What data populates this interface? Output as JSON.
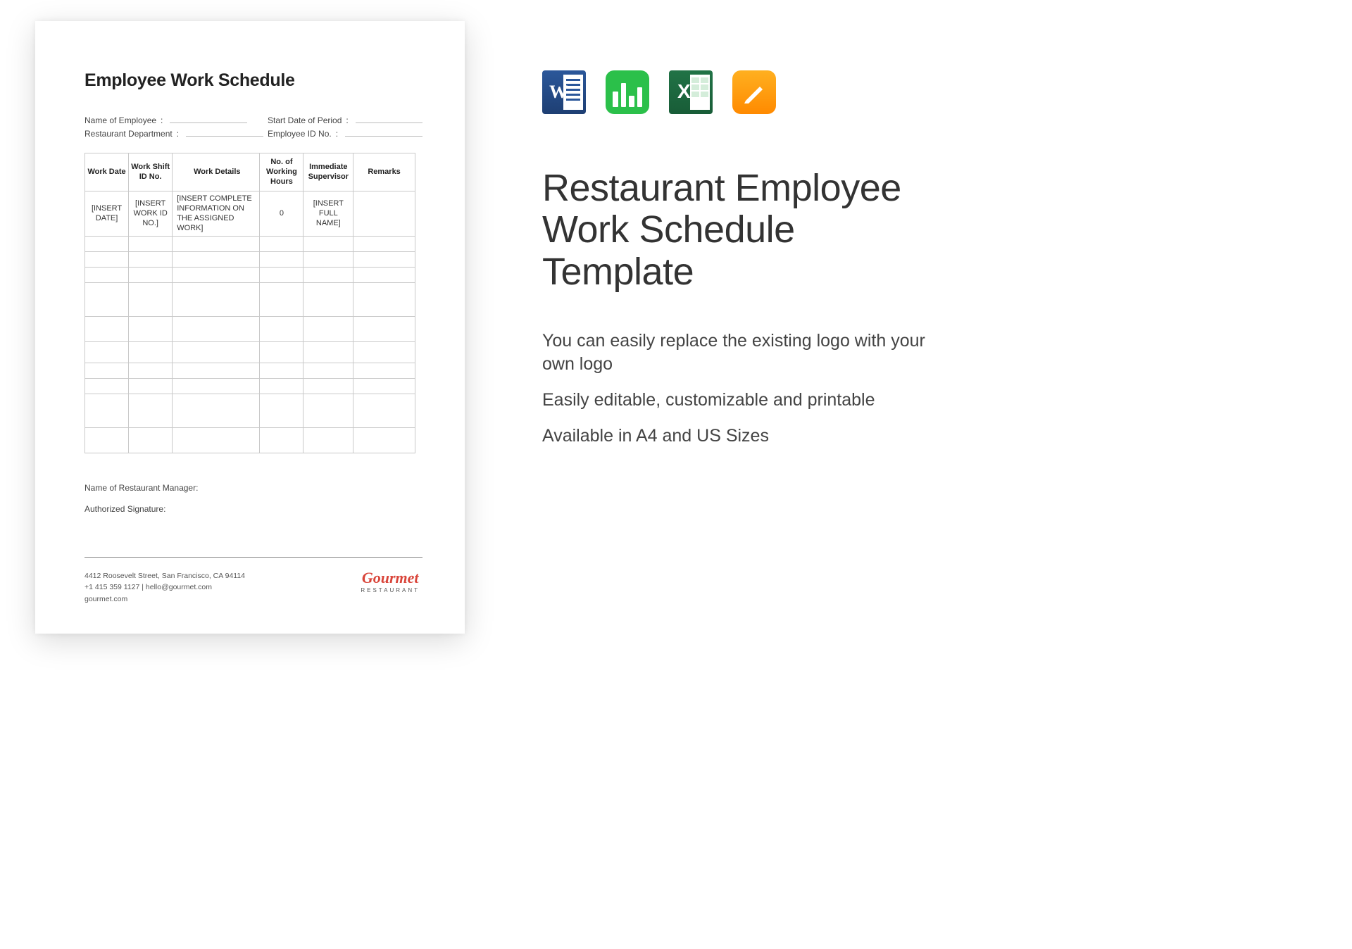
{
  "document": {
    "title": "Employee Work Schedule",
    "meta": {
      "left": [
        {
          "label": "Name of Employee"
        },
        {
          "label": "Restaurant Department"
        }
      ],
      "right": [
        {
          "label": "Start Date of Period"
        },
        {
          "label": "Employee ID No."
        }
      ]
    },
    "table": {
      "headers": [
        "Work Date",
        "Work Shift ID No.",
        "Work Details",
        "No. of Working Hours",
        "Immediate Supervisor",
        "Remarks"
      ],
      "rows": [
        {
          "date": "[INSERT DATE]",
          "shift": "[INSERT WORK ID NO.]",
          "details": "[INSERT COMPLETE INFORMATION ON THE ASSIGNED WORK]",
          "hours": "0",
          "supervisor": "[INSERT FULL NAME]",
          "remarks": ""
        }
      ],
      "blank_rows": 10
    },
    "signature": {
      "manager_label": "Name of Restaurant Manager:",
      "auth_label": "Authorized Signature:"
    },
    "footer": {
      "address": "4412 Roosevelt Street, San Francisco, CA 94114",
      "contact": "+1 415 359 1127 | hello@gourmet.com",
      "website": "gourmet.com",
      "logo_main": "Gourmet",
      "logo_sub": "RESTAURANT"
    }
  },
  "sidebar": {
    "icons": [
      "word",
      "numbers",
      "excel",
      "pages"
    ],
    "title": "Restaurant Employee Work Schedule Template",
    "features": [
      "You can easily replace the existing logo with your own logo",
      "Easily editable, customizable and printable",
      "Available in A4 and US Sizes"
    ]
  }
}
